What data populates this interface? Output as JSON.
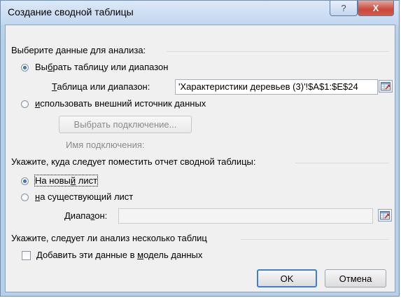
{
  "dialog": {
    "title": "Создание сводной таблицы",
    "help_glyph": "?",
    "close_glyph": "X"
  },
  "section1": {
    "heading": "Выберите данные для анализа:",
    "radio_select_range": {
      "pre": "Вы",
      "underlined": "б",
      "post": "рать таблицу или диапазон",
      "checked": true
    },
    "range_field": {
      "label_pre": "",
      "label_underlined": "Т",
      "label_post": "аблица или диапазон:",
      "value": "'Характеристики деревьев (3)'!$A$1:$E$24"
    },
    "radio_external": {
      "pre": "",
      "underlined": "и",
      "post": "спользовать внешний источник данных",
      "checked": false
    },
    "choose_connection_button": "Выбрать подключение...",
    "connection_name_label": "Имя подключения:"
  },
  "section2": {
    "heading": "Укажите, куда следует поместить отчет сводной таблицы:",
    "radio_new_sheet": {
      "pre": "На новы",
      "underlined": "й",
      "post": " лист",
      "checked": true
    },
    "radio_existing_sheet": {
      "pre": "",
      "underlined": "н",
      "post": "а существующий лист",
      "checked": false
    },
    "range_field": {
      "label_pre": "Диапа",
      "label_underlined": "з",
      "label_post": "он:",
      "value": ""
    }
  },
  "section3": {
    "heading": "Укажите, следует ли анализ несколько таблиц",
    "checkbox": {
      "pre": "Добавить эти данные в ",
      "underlined": "м",
      "post": "одель данных",
      "checked": false
    }
  },
  "footer": {
    "ok_label": "OK",
    "cancel_label": "Отмена"
  }
}
